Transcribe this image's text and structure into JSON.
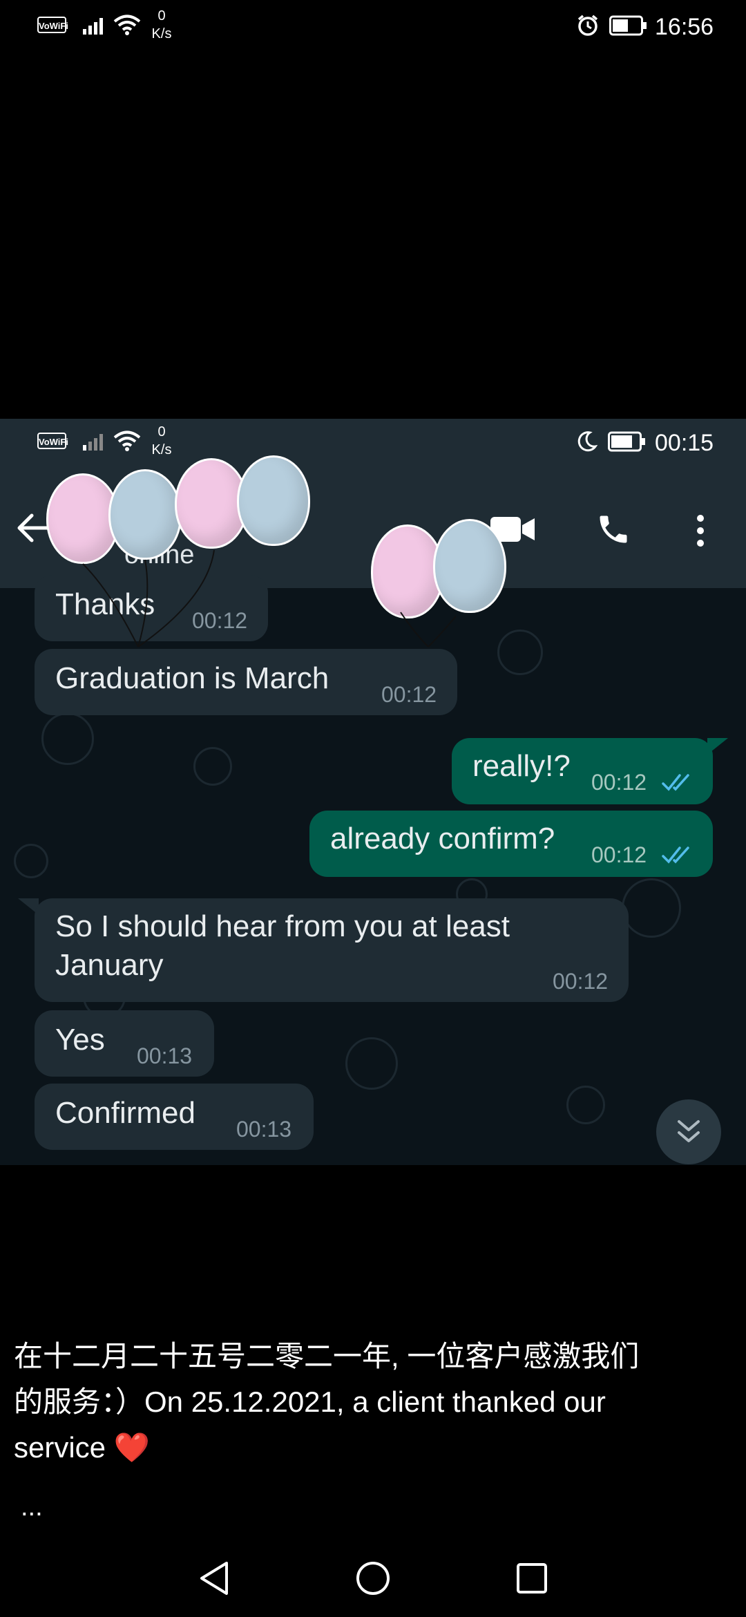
{
  "status_bar": {
    "vowifi": "VoWiFi",
    "speed_value": "0",
    "speed_unit": "K/s",
    "time": "16:56"
  },
  "inner_status_bar": {
    "vowifi": "VoWiFi",
    "speed_value": "0",
    "speed_unit": "K/s",
    "time": "00:15"
  },
  "chat_header": {
    "status_text": "online",
    "icons": [
      "back-arrow-icon",
      "video-call-icon",
      "phone-icon",
      "more-vert-icon"
    ]
  },
  "messages": [
    {
      "dir": "in",
      "text": "Thanks",
      "time": "00:12"
    },
    {
      "dir": "in",
      "text": "Graduation is March",
      "time": "00:12"
    },
    {
      "dir": "out",
      "text": "really!?",
      "time": "00:12",
      "status": "read"
    },
    {
      "dir": "out",
      "text": "already confirm?",
      "time": "00:12",
      "status": "read"
    },
    {
      "dir": "in",
      "text_line1": "So I should hear from you at least",
      "text_line2": "January",
      "time": "00:12"
    },
    {
      "dir": "in",
      "text": "Yes",
      "time": "00:13"
    },
    {
      "dir": "in",
      "text": "Confirmed",
      "time": "00:13"
    }
  ],
  "caption": {
    "line1": "在十二月二十五号二零二一年, 一位客户感激我们",
    "line2": "的服务：）On 25.12.2021, a client thanked our",
    "line3": "service ❤️",
    "more": "..."
  },
  "colors": {
    "incoming_bubble": "#1f2c34",
    "outgoing_bubble": "#005c4b",
    "read_ticks": "#53bdeb",
    "header": "#1f2c34",
    "balloon_pink": "#f2c7e4",
    "balloon_blue": "#b6cedd"
  }
}
